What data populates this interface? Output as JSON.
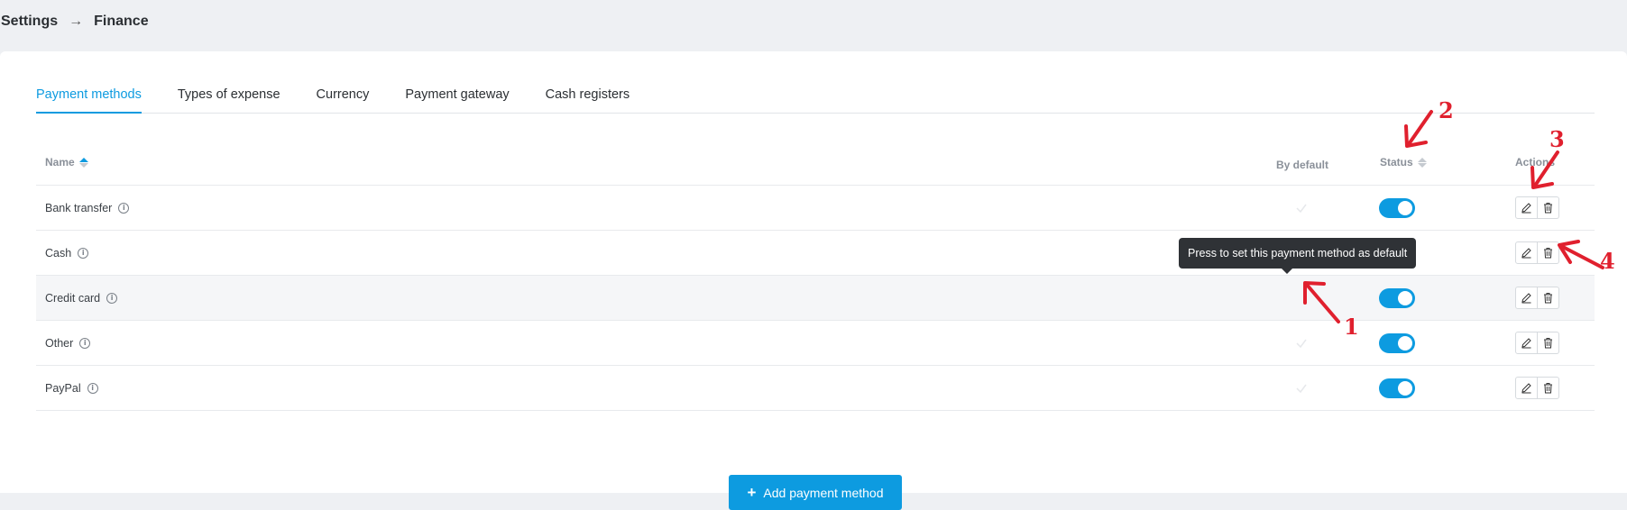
{
  "breadcrumb": {
    "parent": "Settings",
    "separator": "→",
    "current": "Finance"
  },
  "tabs": [
    {
      "label": "Payment methods",
      "active": true
    },
    {
      "label": "Types of expense",
      "active": false
    },
    {
      "label": "Currency",
      "active": false
    },
    {
      "label": "Payment gateway",
      "active": false
    },
    {
      "label": "Cash registers",
      "active": false
    }
  ],
  "table": {
    "columns": {
      "name": "Name",
      "by_default": "By default",
      "status": "Status",
      "actions": "Actions"
    },
    "rows": [
      {
        "name": "Bank transfer",
        "status_on": true
      },
      {
        "name": "Cash",
        "status_on": true
      },
      {
        "name": "Credit card",
        "status_on": true
      },
      {
        "name": "Other",
        "status_on": true
      },
      {
        "name": "PayPal",
        "status_on": true
      }
    ]
  },
  "tooltip": {
    "text": "Press to set this payment method as default"
  },
  "add_button": {
    "label": "Add payment method",
    "icon": "plus-icon"
  },
  "annotations": [
    "1",
    "2",
    "3",
    "4"
  ],
  "colors": {
    "accent": "#0d9be0",
    "annotation": "#e0202e",
    "tooltip_bg": "#2f3236"
  }
}
